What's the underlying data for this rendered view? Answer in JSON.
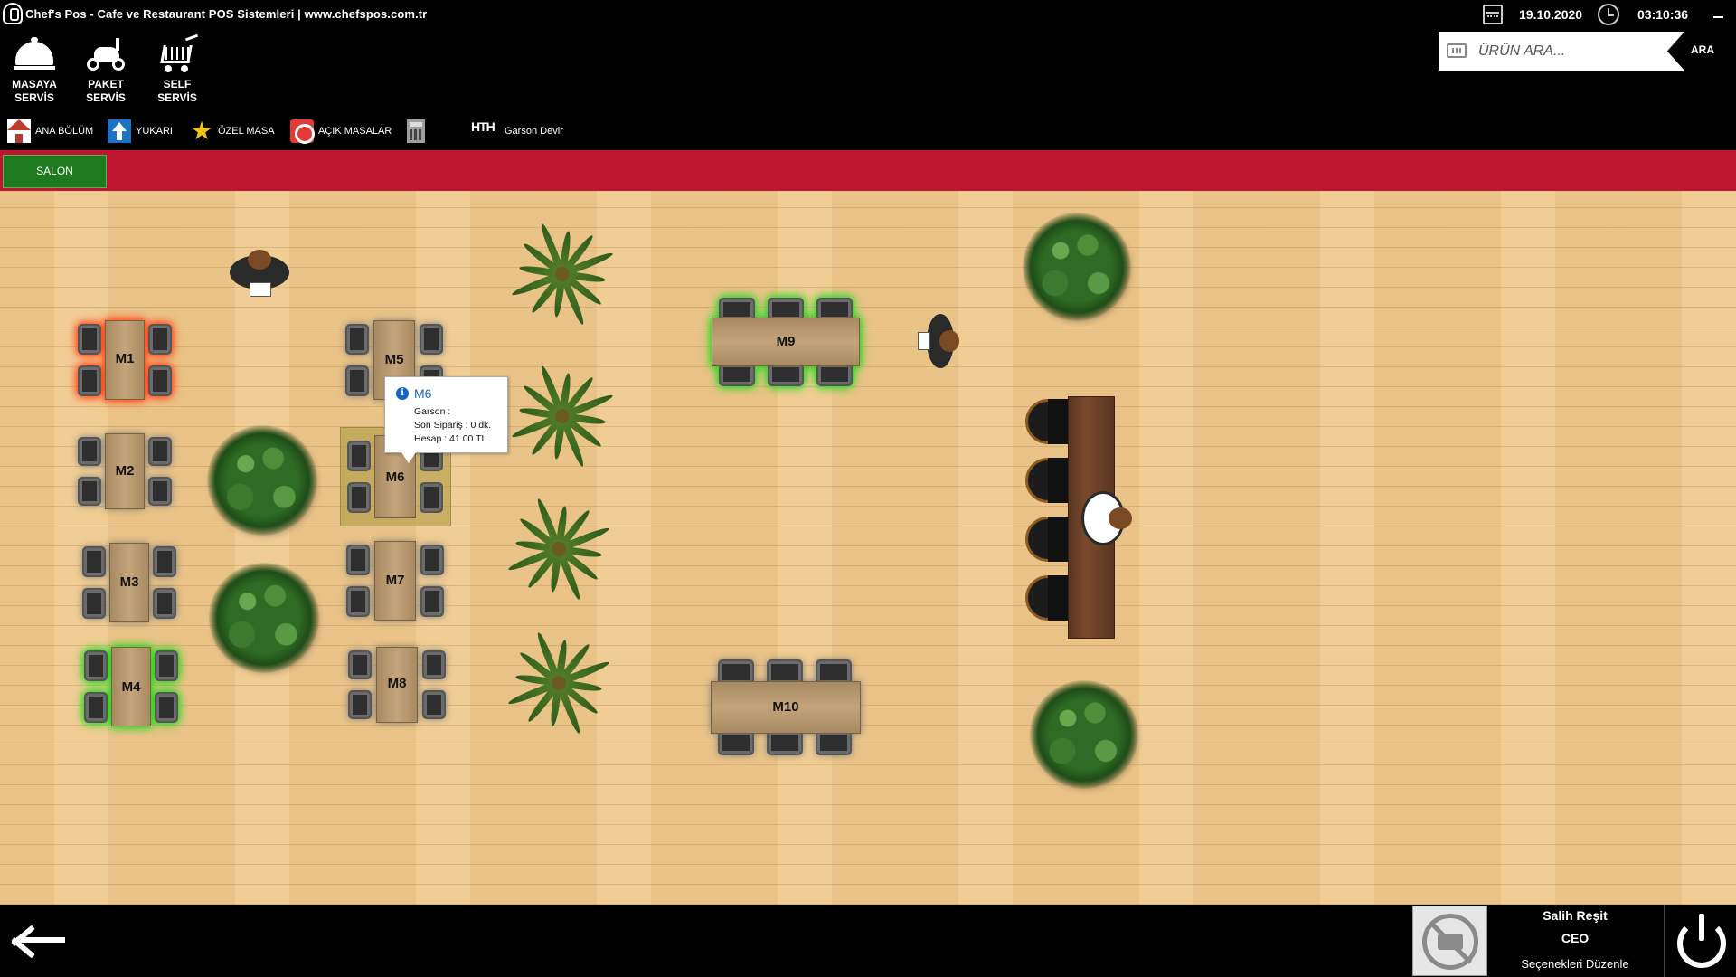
{
  "titlebar": {
    "title": "Chef's Pos - Cafe ve Restaurant POS Sistemleri  |  www.chefspos.com.tr",
    "date": "19.10.2020",
    "time": "03:10:36"
  },
  "service_buttons": [
    {
      "line1": "MASAYA",
      "line2": "SERVİS"
    },
    {
      "line1": "PAKET",
      "line2": "SERVİS"
    },
    {
      "line1": "SELF",
      "line2": "SERVİS"
    }
  ],
  "search": {
    "placeholder": "ÜRÜN ARA...",
    "button": "ARA"
  },
  "toolbar": {
    "home": "ANA BÖLÜM",
    "up": "YUKARI",
    "special": "ÖZEL MASA",
    "open_tables": "AÇIK MASALAR",
    "waiter_transfer": "Garson Devir",
    "waiter_icon_text": "HTH"
  },
  "sections": {
    "salon": "SALON"
  },
  "tables": {
    "m1": "M1",
    "m2": "M2",
    "m3": "M3",
    "m4": "M4",
    "m5": "M5",
    "m6": "M6",
    "m7": "M7",
    "m8": "M8",
    "m9": "M9",
    "m10": "M10"
  },
  "tooltip": {
    "title": "M6",
    "waiter": "Garson :",
    "last_order": "Son Sipariş : 0 dk.",
    "bill": "Hesap : 41.00 TL"
  },
  "user": {
    "name": "Salih Reşit",
    "role": "CEO",
    "edit_options": "Seçenekleri Düzenle"
  },
  "colors": {
    "accent_red": "#c0152f",
    "salon_tab": "#1e7a1e",
    "occupied_glow": "#ff4a20",
    "active_glow": "#34d020"
  }
}
